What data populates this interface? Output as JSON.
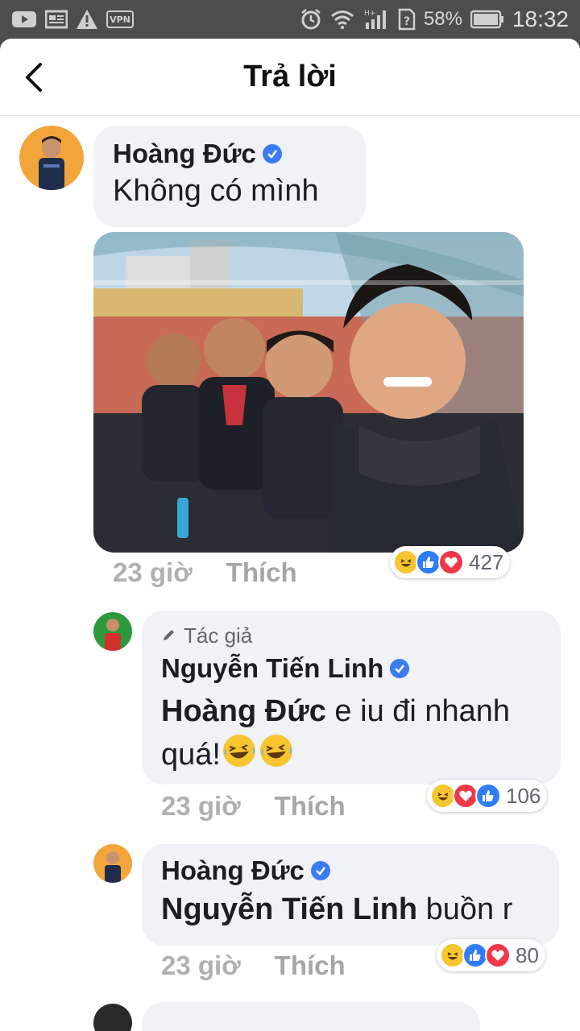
{
  "status_bar": {
    "battery": "58%",
    "time": "18:32",
    "network": "H+",
    "vpn": "VPN"
  },
  "header": {
    "title": "Trả lời"
  },
  "comments": [
    {
      "author": "Hoàng Đức",
      "text": "Không có mình",
      "time": "23 giờ",
      "like_label": "Thích",
      "reaction_count": "427"
    },
    {
      "author_tag": "Tác giả",
      "author": "Nguyễn Tiến Linh",
      "mention": "Hoàng Đức",
      "text_line1": " e iu đi nhanh",
      "text_line2": "quá!",
      "time": "23 giờ",
      "like_label": "Thích",
      "reaction_count": "106"
    },
    {
      "author": "Hoàng Đức",
      "mention": "Nguyễn Tiến Linh",
      "text": " buồn r",
      "time": "23 giờ",
      "like_label": "Thích",
      "reaction_count": "80"
    }
  ],
  "colors": {
    "verified": "#3b7bf2",
    "bubble": "#f0f2f5",
    "like": "#2e7df6",
    "love": "#f0384a",
    "haha": "#f7c530"
  }
}
